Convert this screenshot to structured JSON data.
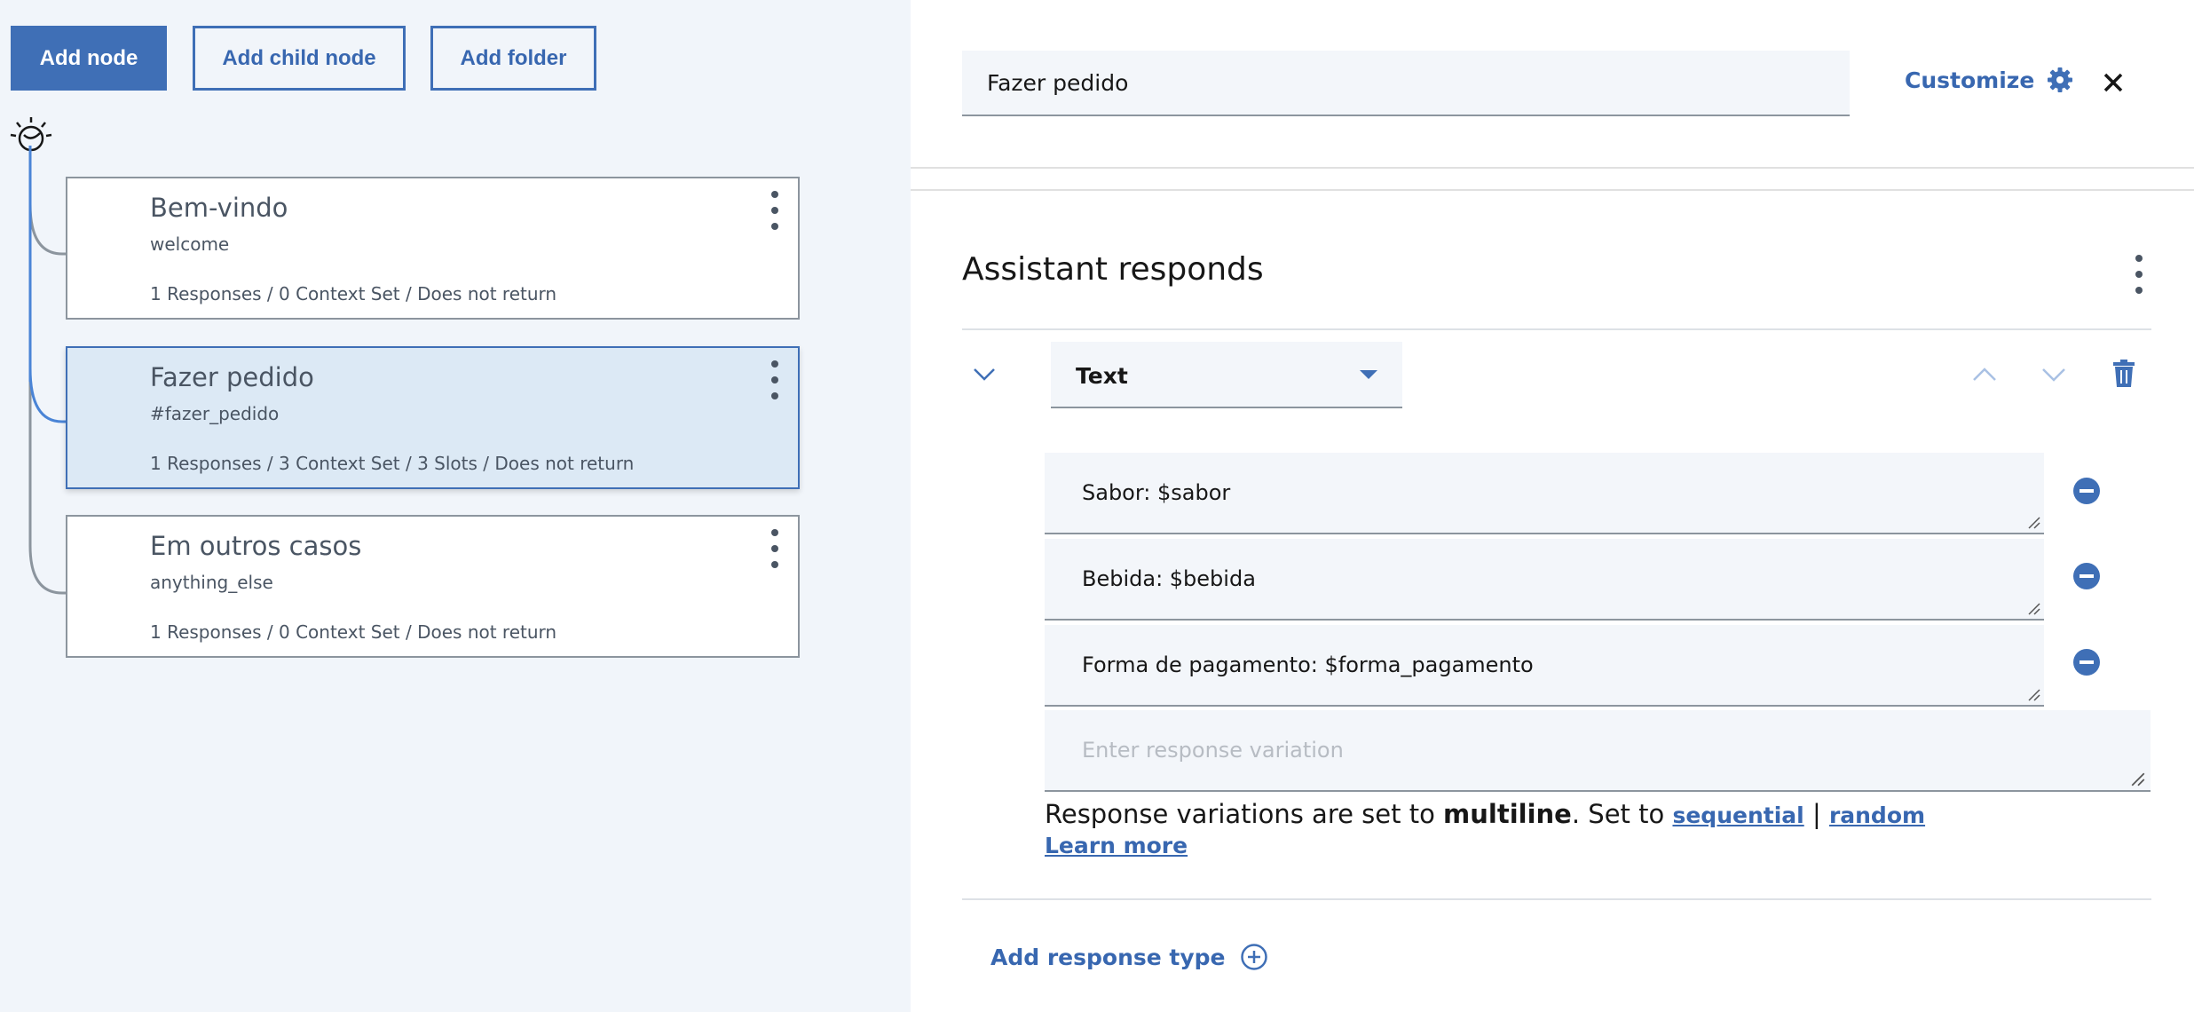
{
  "toolbar": {
    "add_node": "Add node",
    "add_child_node": "Add child node",
    "add_folder": "Add folder"
  },
  "tree": {
    "nodes": [
      {
        "title": "Bem-vindo",
        "condition": "welcome",
        "meta": "1 Responses / 0 Context Set / Does not return",
        "selected": false
      },
      {
        "title": "Fazer pedido",
        "condition": "#fazer_pedido",
        "meta": "1 Responses / 3 Context Set / 3 Slots / Does not return",
        "selected": true
      },
      {
        "title": "Em outros casos",
        "condition": "anything_else",
        "meta": "1 Responses / 0 Context Set / Does not return",
        "selected": false
      }
    ]
  },
  "editor": {
    "node_name": "Fazer pedido",
    "customize_label": "Customize",
    "section_title": "Assistant responds",
    "response_type": "Text",
    "variations": [
      "Sabor: $sabor",
      "Bebida: $bebida",
      "Forma de pagamento: $forma_pagamento"
    ],
    "new_variation_placeholder": "Enter response variation",
    "info": {
      "prefix": "Response variations are set to ",
      "mode": "multiline",
      "middle": ". Set to ",
      "option_sequential": "sequential",
      "divider": "|",
      "option_random": "random",
      "learn_more": "Learn more"
    },
    "add_response_type": "Add response type"
  },
  "colors": {
    "accent": "#3f6fb6",
    "selected_node_bg": "#dce9f5",
    "left_pane_bg": "#f1f5fa"
  }
}
